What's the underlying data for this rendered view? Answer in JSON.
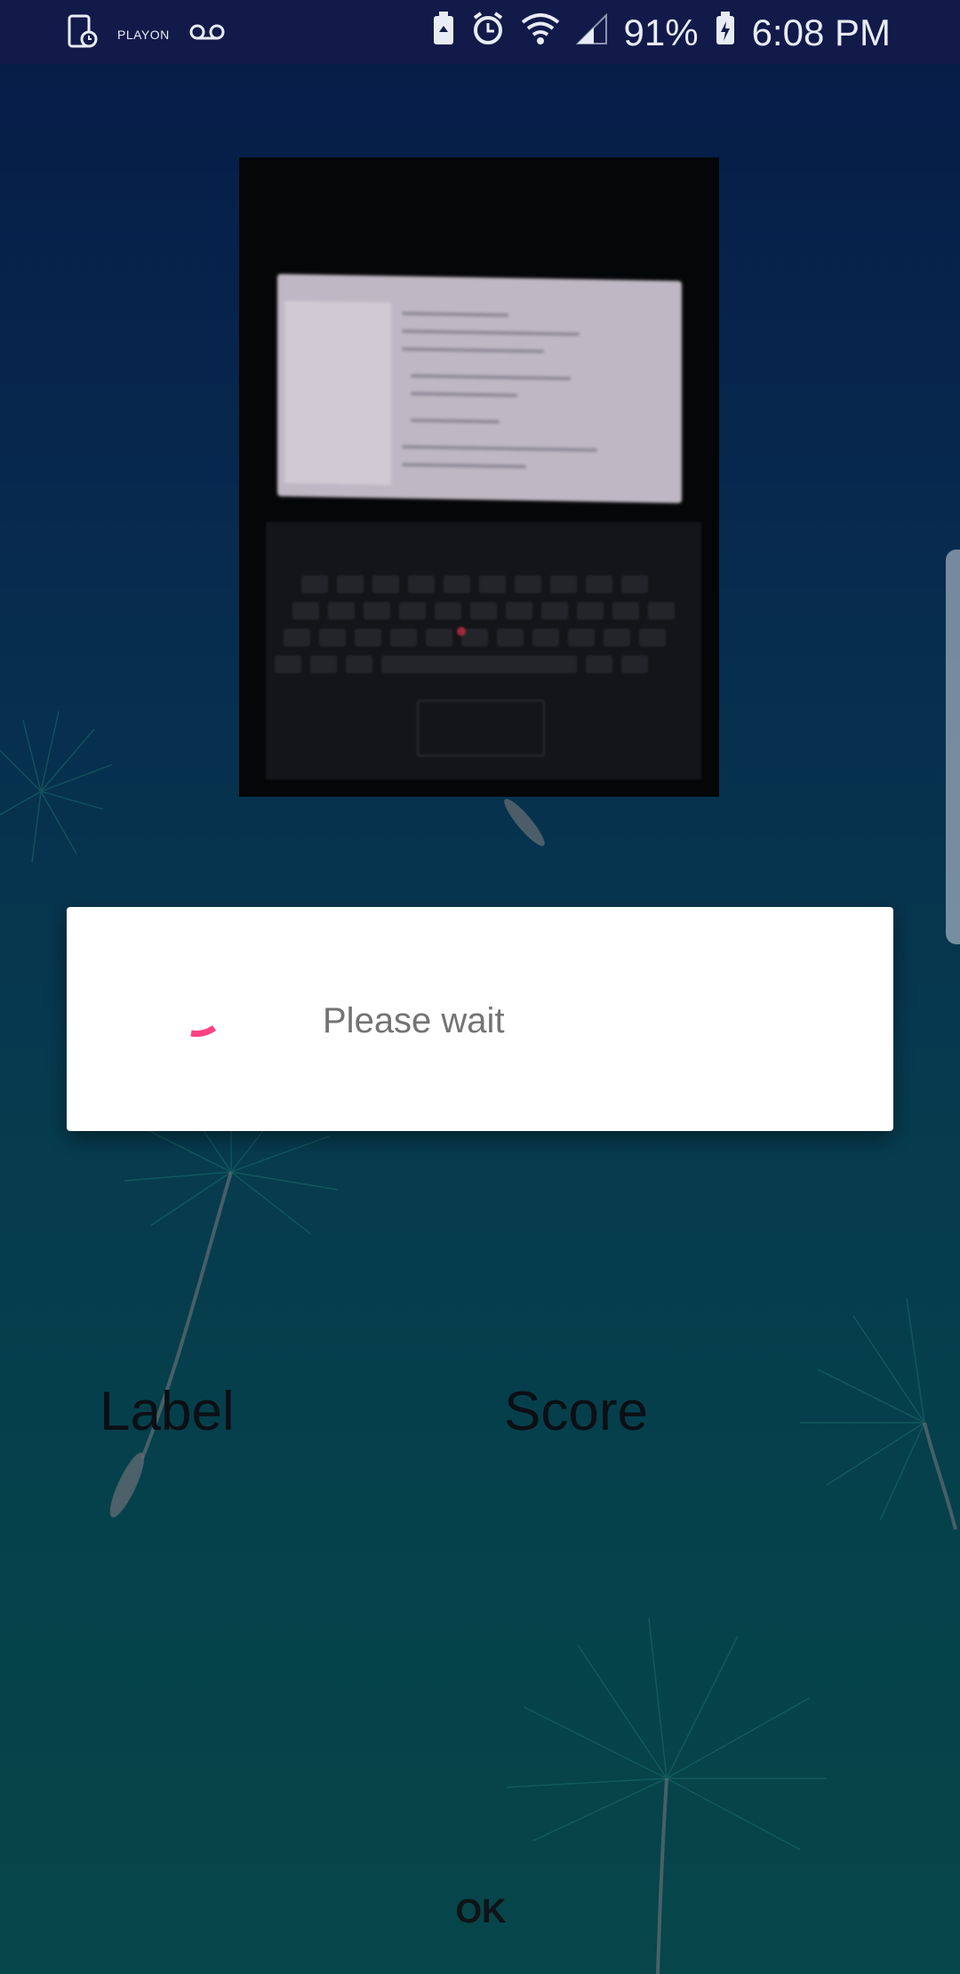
{
  "status_bar": {
    "left_icons": [
      "screen-time-icon",
      "playon-icon",
      "voicemail-icon"
    ],
    "playon_text": "PLAYON",
    "right_icons": [
      "battery-saver-icon",
      "alarm-icon",
      "wifi-icon",
      "signal-icon",
      "battery-charging-icon"
    ],
    "battery_percent": "91%",
    "time": "6:08 PM"
  },
  "photo": {
    "description_icon": "captured-image"
  },
  "dialog": {
    "message": "Please wait",
    "spinner_color": "#ff4081"
  },
  "results": {
    "label_text": "Label",
    "score_text": "Score"
  },
  "actions": {
    "ok_label": "OK"
  },
  "colors": {
    "status_bar_bg": "#121a4a",
    "dialog_bg": "#ffffff",
    "accent": "#ff4081"
  }
}
